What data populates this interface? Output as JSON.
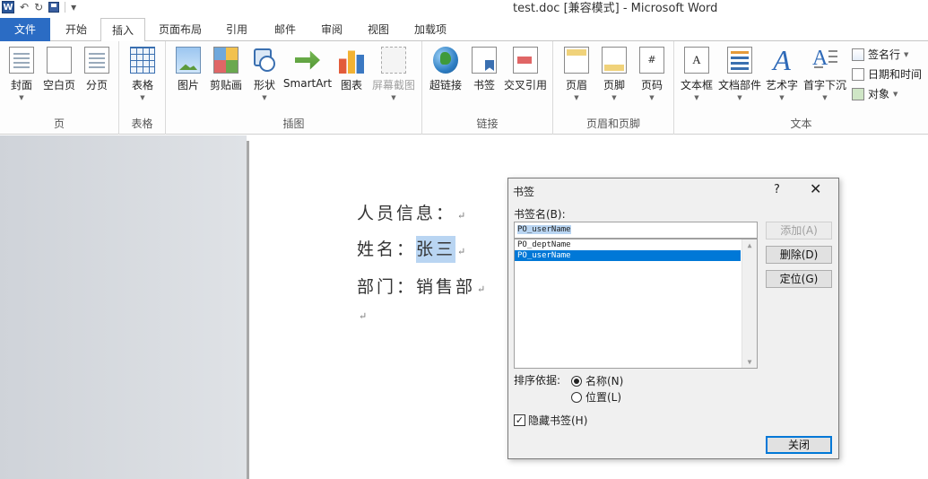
{
  "titlebar": {
    "title": "test.doc [兼容模式] - Microsoft Word",
    "word_logo": "W"
  },
  "tabs": [
    "文件",
    "开始",
    "插入",
    "页面布局",
    "引用",
    "邮件",
    "审阅",
    "视图",
    "加载项"
  ],
  "active_tab": "插入",
  "ribbon": {
    "groups": {
      "pages": {
        "label": "页",
        "buttons": [
          "封面",
          "空白页",
          "分页"
        ]
      },
      "tables": {
        "label": "表格",
        "buttons": [
          "表格"
        ]
      },
      "illustrations": {
        "label": "插图",
        "buttons": [
          "图片",
          "剪贴画",
          "形状",
          "SmartArt",
          "图表",
          "屏幕截图"
        ]
      },
      "links": {
        "label": "链接",
        "buttons": [
          "超链接",
          "书签",
          "交叉引用"
        ]
      },
      "header_footer": {
        "label": "页眉和页脚",
        "buttons": [
          "页眉",
          "页脚",
          "页码"
        ]
      },
      "text": {
        "label": "文本",
        "buttons": [
          "文本框",
          "文档部件",
          "艺术字",
          "首字下沉"
        ],
        "small": [
          "签名行",
          "日期和时间",
          "对象"
        ]
      }
    },
    "icons": {
      "pagenum_glyph": "#",
      "textbox_glyph": "A",
      "wordart_glyph": "A",
      "dropcap_glyph": "A"
    }
  },
  "document": {
    "line1": "人员信息：",
    "line2_label": "姓名：",
    "line2_value": "张三",
    "line3": "部门：销售部",
    "para_mark": "↵"
  },
  "dialog": {
    "title": "书签",
    "help": "?",
    "close": "✕",
    "name_label": "书签名(B):",
    "input_value": "PO_userName",
    "list": [
      "PO_deptName",
      "PO_userName"
    ],
    "selected": "PO_userName",
    "buttons": {
      "add": "添加(A)",
      "delete": "删除(D)",
      "goto": "定位(G)",
      "close": "关闭"
    },
    "sort_label": "排序依据:",
    "sort_options": [
      "名称(N)",
      "位置(L)"
    ],
    "sort_selected": "名称(N)",
    "hidden_label": "隐藏书签(H)",
    "hidden_checked": true,
    "check_glyph": "✓"
  }
}
